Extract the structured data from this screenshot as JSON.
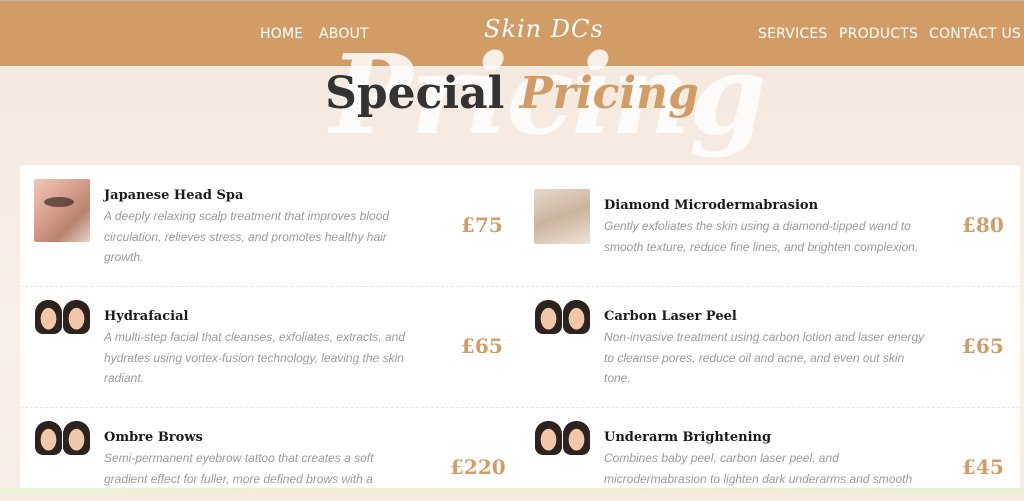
{
  "nav": {
    "home": "HOME",
    "about": "ABOUT",
    "logo": "Skin DCs",
    "services": "SERVICES",
    "products": "PRODUCTS",
    "contact": "CONTACT US"
  },
  "heading": {
    "watermark": "Pricing",
    "main": "Special",
    "accent": "Pricing"
  },
  "items": [
    {
      "title": "Japanese Head Spa",
      "desc": "A deeply relaxing scalp treatment that improves blood circulation, relieves stress, and promotes healthy hair growth.",
      "price": "£75",
      "thumb": "face-closeup-image"
    },
    {
      "title": "Diamond Microdermabrasion",
      "desc": "Gently exfoliates the skin using a diamond-tipped wand to smooth texture, reduce fine lines, and brighten complexion.",
      "price": "£80",
      "thumb": "skin-closeup-image"
    },
    {
      "title": "Hydrafacial",
      "desc": "A multi-step facial that cleanses, exfoliates, extracts, and hydrates using vortex-fusion technology, leaving the skin radiant.",
      "price": "£65",
      "thumb": "before-after-faces-image"
    },
    {
      "title": "Carbon Laser Peel",
      "desc": "Non-invasive treatment using carbon lotion and laser energy to cleanse pores, reduce oil and acne, and even out skin tone.",
      "price": "£65",
      "thumb": "before-after-faces-image"
    },
    {
      "title": "Ombre Brows",
      "desc": "Semi-permanent eyebrow tattoo that creates a soft gradient effect for fuller, more defined brows with a",
      "price": "£220",
      "thumb": "before-after-faces-image"
    },
    {
      "title": "Underarm Brightening",
      "desc": "Combines baby peel, carbon laser peel, and microdermabrasion to lighten dark underarms and smooth",
      "price": "£45",
      "thumb": "before-after-faces-image"
    }
  ],
  "colors": {
    "accent": "#d29c67",
    "heading": "#333333",
    "desc": "#9a9a9a"
  }
}
